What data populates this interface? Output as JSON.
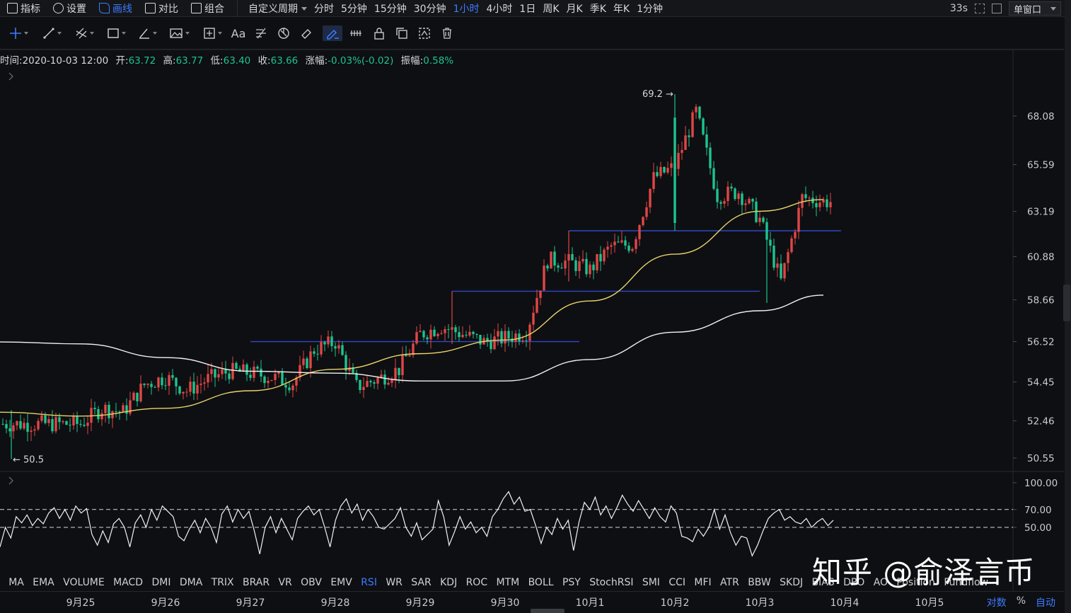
{
  "toolbar": {
    "indicator_label": "指标",
    "settings_label": "设置",
    "draw_label": "画线",
    "compare_label": "对比",
    "combo_label": "组合",
    "custom_period_label": "自定义周期",
    "periods": [
      "分时",
      "5分钟",
      "15分钟",
      "30分钟",
      "1小时",
      "4小时",
      "1日",
      "周K",
      "月K",
      "季K",
      "年K",
      "1分钟"
    ],
    "active_period": "1小时",
    "countdown": "33s",
    "window_mode": "单窗口"
  },
  "drawing_tools": {
    "text_tool_label": "Aa"
  },
  "info": {
    "time_label": "时间:",
    "time_value": "2020-10-03 12:00",
    "open_label": "开:",
    "open_value": "63.72",
    "high_label": "高:",
    "high_value": "63.77",
    "low_label": "低:",
    "low_value": "63.40",
    "close_label": "收:",
    "close_value": "63.66",
    "change_label": "涨幅:",
    "change_value": "-0.03%(-0.02)",
    "amplitude_label": "振幅:",
    "amplitude_value": "0.58%"
  },
  "chart_data": [
    {
      "type": "candlestick",
      "title": "",
      "interval": "1小时",
      "y_ticks": [
        "68.08",
        "65.59",
        "63.19",
        "60.88",
        "58.66",
        "56.52",
        "54.45",
        "52.46",
        "50.55"
      ],
      "ylim": [
        49.9,
        70.4
      ],
      "high_marker": "69.2",
      "low_marker": "50.5",
      "close_path": [
        [
          "09-25 00:00",
          52.3
        ],
        [
          "09-25 06:00",
          53.1
        ],
        [
          "09-25 12:00",
          52.9
        ],
        [
          "09-25 18:00",
          54.3
        ],
        [
          "09-26 00:00",
          54.7
        ],
        [
          "09-26 06:00",
          54.0
        ],
        [
          "09-26 12:00",
          54.6
        ],
        [
          "09-26 18:00",
          55.0
        ],
        [
          "09-27 00:00",
          54.9
        ],
        [
          "09-27 06:00",
          54.7
        ],
        [
          "09-27 12:00",
          54.4
        ],
        [
          "09-27 18:00",
          56.1
        ],
        [
          "09-28 00:00",
          56.5
        ],
        [
          "09-28 06:00",
          54.2
        ],
        [
          "09-28 12:00",
          54.6
        ],
        [
          "09-28 18:00",
          55.1
        ],
        [
          "09-29 00:00",
          56.9
        ],
        [
          "09-29 06:00",
          57.3
        ],
        [
          "09-29 12:00",
          56.9
        ],
        [
          "09-29 18:00",
          56.5
        ],
        [
          "09-30 00:00",
          56.7
        ],
        [
          "09-30 06:00",
          57.0
        ],
        [
          "09-30 12:00",
          60.7
        ],
        [
          "09-30 18:00",
          60.6
        ],
        [
          "10-01 00:00",
          60.2
        ],
        [
          "10-01 06:00",
          61.4
        ],
        [
          "10-01 12:00",
          61.5
        ],
        [
          "10-01 18:00",
          64.9
        ],
        [
          "10-02 00:00",
          65.5
        ],
        [
          "10-02 06:00",
          68.3
        ],
        [
          "10-02 12:00",
          64.0
        ],
        [
          "10-02 18:00",
          64.2
        ],
        [
          "10-03 00:00",
          62.8
        ],
        [
          "10-03 06:00",
          59.6
        ],
        [
          "10-03 12:00",
          63.9
        ],
        [
          "10-03 18:00",
          63.7
        ]
      ],
      "horizontal_lines": [
        {
          "value": 56.52,
          "from": "09-27 00:00",
          "to": "09-30 21:00"
        },
        {
          "value": 59.1,
          "from": "09-29 09:00",
          "to": "10-03 00:00"
        },
        {
          "value": 62.2,
          "from": "09-30 18:00",
          "to": "10-03 23:00"
        }
      ],
      "moving_averages": [
        {
          "color": "#e8d36a",
          "values": [
            [
              "09-25 00:00",
              52.7
            ],
            [
              "09-26 00:00",
              53.1
            ],
            [
              "09-27 00:00",
              54.0
            ],
            [
              "09-28 00:00",
              55.1
            ],
            [
              "09-29 00:00",
              55.9
            ],
            [
              "09-30 00:00",
              56.6
            ],
            [
              "10-01 00:00",
              58.6
            ],
            [
              "10-02 00:00",
              61.0
            ],
            [
              "10-03 00:00",
              63.2
            ],
            [
              "10-03 18:00",
              63.8
            ]
          ]
        },
        {
          "color": "#f2f2f2",
          "values": [
            [
              "09-25 00:00",
              56.4
            ],
            [
              "09-26 00:00",
              55.7
            ],
            [
              "09-27 00:00",
              55.0
            ],
            [
              "09-28 00:00",
              54.9
            ],
            [
              "09-29 00:00",
              54.5
            ],
            [
              "09-30 00:00",
              54.5
            ],
            [
              "10-01 00:00",
              55.6
            ],
            [
              "10-02 00:00",
              57.0
            ],
            [
              "10-03 00:00",
              58.1
            ],
            [
              "10-03 18:00",
              58.9
            ]
          ]
        }
      ]
    },
    {
      "type": "line",
      "indicator": "RSI",
      "y_ticks": [
        "100.00",
        "70.00",
        "50.00"
      ],
      "ylim": [
        0,
        100
      ],
      "reference_lines": [
        70,
        50
      ],
      "values": [
        28,
        50,
        38,
        62,
        55,
        64,
        52,
        60,
        54,
        66,
        72,
        60,
        70,
        58,
        74,
        66,
        71,
        42,
        30,
        46,
        33,
        54,
        60,
        50,
        28,
        55,
        64,
        50,
        70,
        58,
        74,
        68,
        62,
        40,
        35,
        48,
        58,
        44,
        60,
        50,
        33,
        65,
        74,
        56,
        70,
        60,
        68,
        46,
        20,
        50,
        62,
        44,
        60,
        48,
        36,
        60,
        68,
        74,
        64,
        70,
        50,
        28,
        58,
        74,
        82,
        66,
        76,
        58,
        70,
        62,
        50,
        48,
        54,
        60,
        72,
        50,
        40,
        55,
        36,
        42,
        48,
        80,
        62,
        30,
        45,
        62,
        48,
        56,
        44,
        50,
        40,
        62,
        70,
        82,
        90,
        76,
        84,
        68,
        70,
        52,
        32,
        50,
        42,
        60,
        48,
        58,
        24,
        56,
        78,
        70,
        84,
        64,
        74,
        60,
        72,
        86,
        76,
        68,
        80,
        70,
        60,
        72,
        62,
        56,
        74,
        66,
        40,
        38,
        34,
        48,
        40,
        50,
        70,
        48,
        64,
        44,
        30,
        40,
        38,
        18,
        30,
        46,
        60,
        66,
        70,
        58,
        62,
        56,
        54,
        60,
        50,
        56,
        60,
        52,
        58
      ]
    }
  ],
  "indicator_tabs": [
    "MA",
    "EMA",
    "VOLUME",
    "MACD",
    "DMI",
    "DMA",
    "TRIX",
    "BRAR",
    "VR",
    "OBV",
    "EMV",
    "RSI",
    "WR",
    "SAR",
    "KDJ",
    "ROC",
    "MTM",
    "BOLL",
    "PSY",
    "StochRSI",
    "SMI",
    "CCI",
    "MFI",
    "ATR",
    "BBW",
    "SKDJ",
    "BIAS",
    "DPO",
    "AO",
    "Position",
    "Fundflow"
  ],
  "active_indicator": "RSI",
  "x_axis": {
    "labels": [
      "9月25",
      "9月26",
      "9月27",
      "9月28",
      "9月29",
      "9月30",
      "10月1",
      "10月2",
      "10月3",
      "10月4",
      "10月5"
    ]
  },
  "axis_controls": {
    "log_label": "对数",
    "percent_label": "%",
    "auto_label": "自动"
  },
  "watermark": "知乎 @俞泽言币",
  "colors": {
    "up": "#e04646",
    "down": "#1dc48f",
    "accent": "#3d7bff",
    "ma_short": "#e8d36a",
    "ma_long": "#f2f2f2",
    "hline": "#2f49c8"
  }
}
